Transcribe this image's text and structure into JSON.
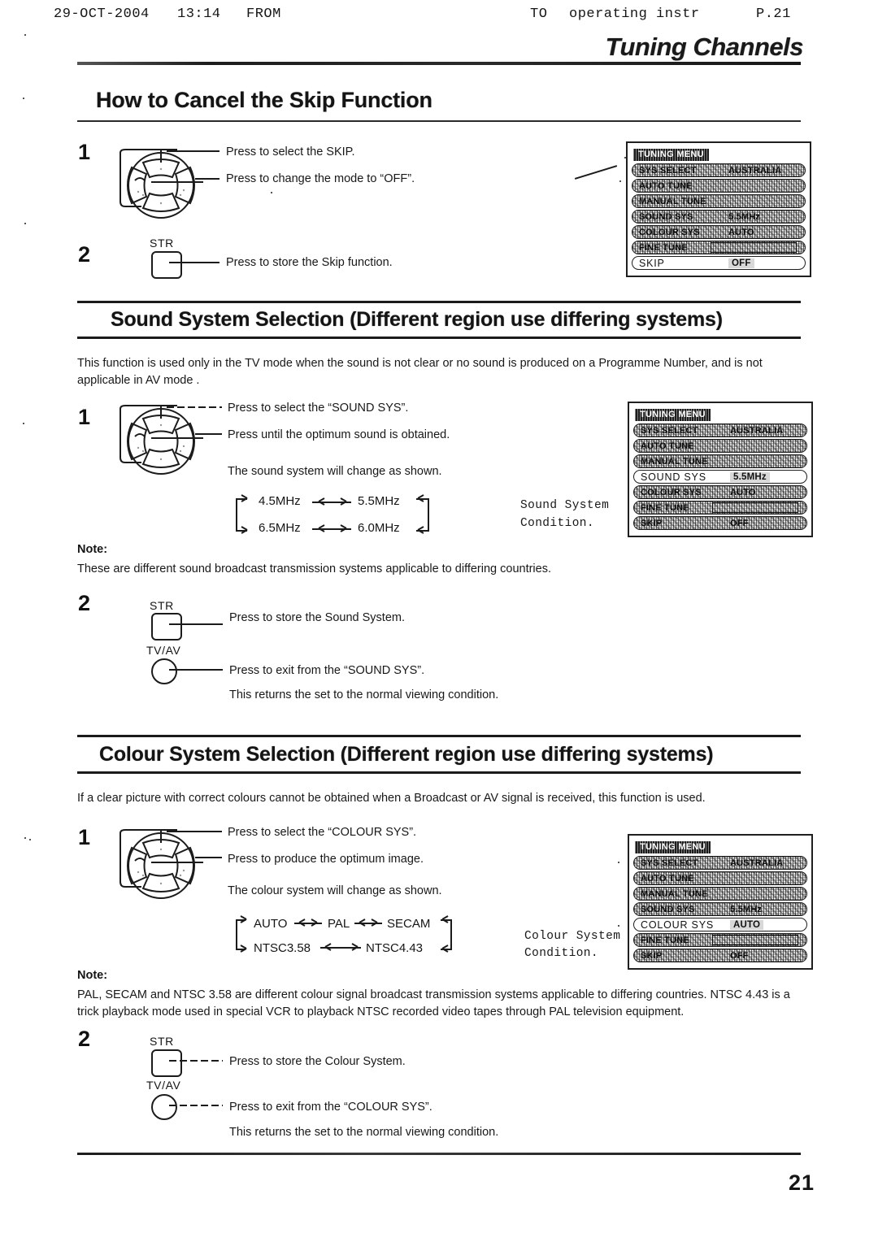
{
  "fax_header": {
    "date": "29-OCT-2004",
    "time": "13:14",
    "from_label": "FROM",
    "to_label": "TO",
    "destination": "operating instr",
    "page": "P.21"
  },
  "running_head": "Tuning Channels",
  "page_number": "21",
  "sections": [
    {
      "id": "skip",
      "title": "How to Cancel the Skip Function",
      "steps": [
        {
          "num": "1",
          "control": "d-pad",
          "captions": [
            "Press to select the SKIP.",
            "Press to change the mode to “OFF”."
          ]
        },
        {
          "num": "2",
          "control": "STR",
          "button_label": "STR",
          "captions": [
            "Press to store the Skip function."
          ]
        }
      ],
      "osd": {
        "title": "TUNING MENU",
        "rows": [
          {
            "key": "SYS SELECT",
            "value": "AUSTRALIA",
            "state": "noisy"
          },
          {
            "key": "AUTO TUNE",
            "value": "",
            "state": "noisy"
          },
          {
            "key": "MANUAL TUNE",
            "value": "",
            "state": "noisy"
          },
          {
            "key": "SOUND SYS",
            "value": "5.5MHz",
            "state": "noisy"
          },
          {
            "key": "COLOUR SYS",
            "value": "AUTO",
            "state": "noisy"
          },
          {
            "key": "FINE TUNE",
            "value": "",
            "state": "noisy-fine"
          },
          {
            "key": "SKIP",
            "value": "OFF",
            "state": "clear-highlight"
          }
        ]
      }
    },
    {
      "id": "sound",
      "title": "Sound System Selection (Different region use differing systems)",
      "intro": "This function is used only in the TV mode when the sound is not clear or no sound is produced on a Programme Number, and is not applicable in AV mode .",
      "steps": [
        {
          "num": "1",
          "control": "d-pad",
          "captions": [
            "Press to select the “SOUND SYS”.",
            "Press until the optimum sound is obtained.",
            "The sound system will change as shown."
          ]
        },
        {
          "num": "2",
          "control": "STR+TVAV",
          "button_label": "STR",
          "button_label2": "TV/AV",
          "captions": [
            "Press to store the Sound System.",
            "Press to exit from the “SOUND SYS”.",
            "This returns the set to the normal viewing condition."
          ]
        }
      ],
      "cycle": {
        "caption_line1": "Sound System",
        "caption_line2": "Condition.",
        "top": [
          "4.5MHz",
          "5.5MHz"
        ],
        "bottom": [
          "6.5MHz",
          "6.0MHz"
        ]
      },
      "note_label": "Note:",
      "note": "These are different sound broadcast transmission systems applicable to differing countries.",
      "osd": {
        "title": "TUNING MENU",
        "rows": [
          {
            "key": "SYS SELECT",
            "value": "AUSTRALIA",
            "state": "noisy"
          },
          {
            "key": "AUTO TUNE",
            "value": "",
            "state": "noisy"
          },
          {
            "key": "MANUAL TUNE",
            "value": "",
            "state": "noisy"
          },
          {
            "key": "SOUND SYS",
            "value": "5.5MHz",
            "state": "clear-highlight"
          },
          {
            "key": "COLOUR SYS",
            "value": "AUTO",
            "state": "noisy"
          },
          {
            "key": "FINE TUNE",
            "value": "",
            "state": "noisy-fine"
          },
          {
            "key": "SKIP",
            "value": "OFF",
            "state": "noisy"
          }
        ]
      }
    },
    {
      "id": "colour",
      "title": "Colour System Selection (Different region use differing systems)",
      "intro": "If a clear picture with correct colours cannot be obtained when a Broadcast or AV signal is received, this function is used.",
      "steps": [
        {
          "num": "1",
          "control": "d-pad",
          "captions": [
            "Press to select the “COLOUR SYS”.",
            "Press to produce the optimum image.",
            "The colour system will change as shown."
          ]
        },
        {
          "num": "2",
          "control": "STR+TVAV",
          "button_label": "STR",
          "button_label2": "TV/AV",
          "captions": [
            "Press to store the Colour System.",
            "Press to exit from the “COLOUR SYS”.",
            "This returns the set to the normal viewing condition."
          ]
        }
      ],
      "cycle": {
        "caption_line1": "Colour  System",
        "caption_line2": "Condition.",
        "top": [
          "AUTO",
          "PAL",
          "SECAM"
        ],
        "bottom": [
          "NTSC3.58",
          "NTSC4.43"
        ]
      },
      "note_label": "Note:",
      "note": "PAL, SECAM and NTSC 3.58 are different colour signal broadcast transmission systems applicable to differing countries. NTSC 4.43 is a trick playback mode used in special VCR to playback NTSC recorded video tapes through PAL television equipment.",
      "osd": {
        "title": "TUNING MENU",
        "rows": [
          {
            "key": "SYS SELECT",
            "value": "AUSTRALIA",
            "state": "noisy"
          },
          {
            "key": "AUTO TUNE",
            "value": "",
            "state": "noisy"
          },
          {
            "key": "MANUAL TUNE",
            "value": "",
            "state": "noisy"
          },
          {
            "key": "SOUND SYS",
            "value": "5.5MHz",
            "state": "noisy"
          },
          {
            "key": "COLOUR SYS",
            "value": "AUTO",
            "state": "clear-highlight"
          },
          {
            "key": "FINE TUNE",
            "value": "",
            "state": "noisy-fine"
          },
          {
            "key": "SKIP",
            "value": "OFF",
            "state": "noisy"
          }
        ]
      }
    }
  ]
}
